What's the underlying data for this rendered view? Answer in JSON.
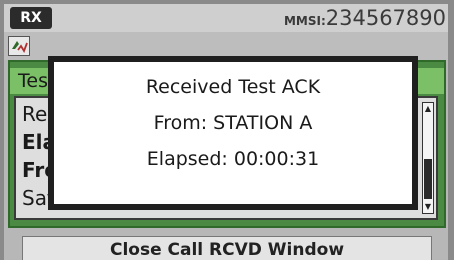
{
  "status_bar": {
    "rx_badge": "RX",
    "mmsi_label": "MMSI:",
    "mmsi_value": "234567890"
  },
  "content": {
    "header_partial": "Tes",
    "list_items": [
      "Rec",
      "Ela",
      "Fro",
      "Safety"
    ]
  },
  "popup": {
    "line1": "Received Test ACK",
    "line2": "From: STATION A",
    "line3": "Elapsed: 00:00:31"
  },
  "bottom": {
    "close_button_label": "Close Call RCVD Window"
  },
  "icons": {
    "tab_icon": "call-log-icon",
    "scroll_up": "scroll-up-arrow-icon",
    "scroll_down": "scroll-down-arrow-icon"
  }
}
